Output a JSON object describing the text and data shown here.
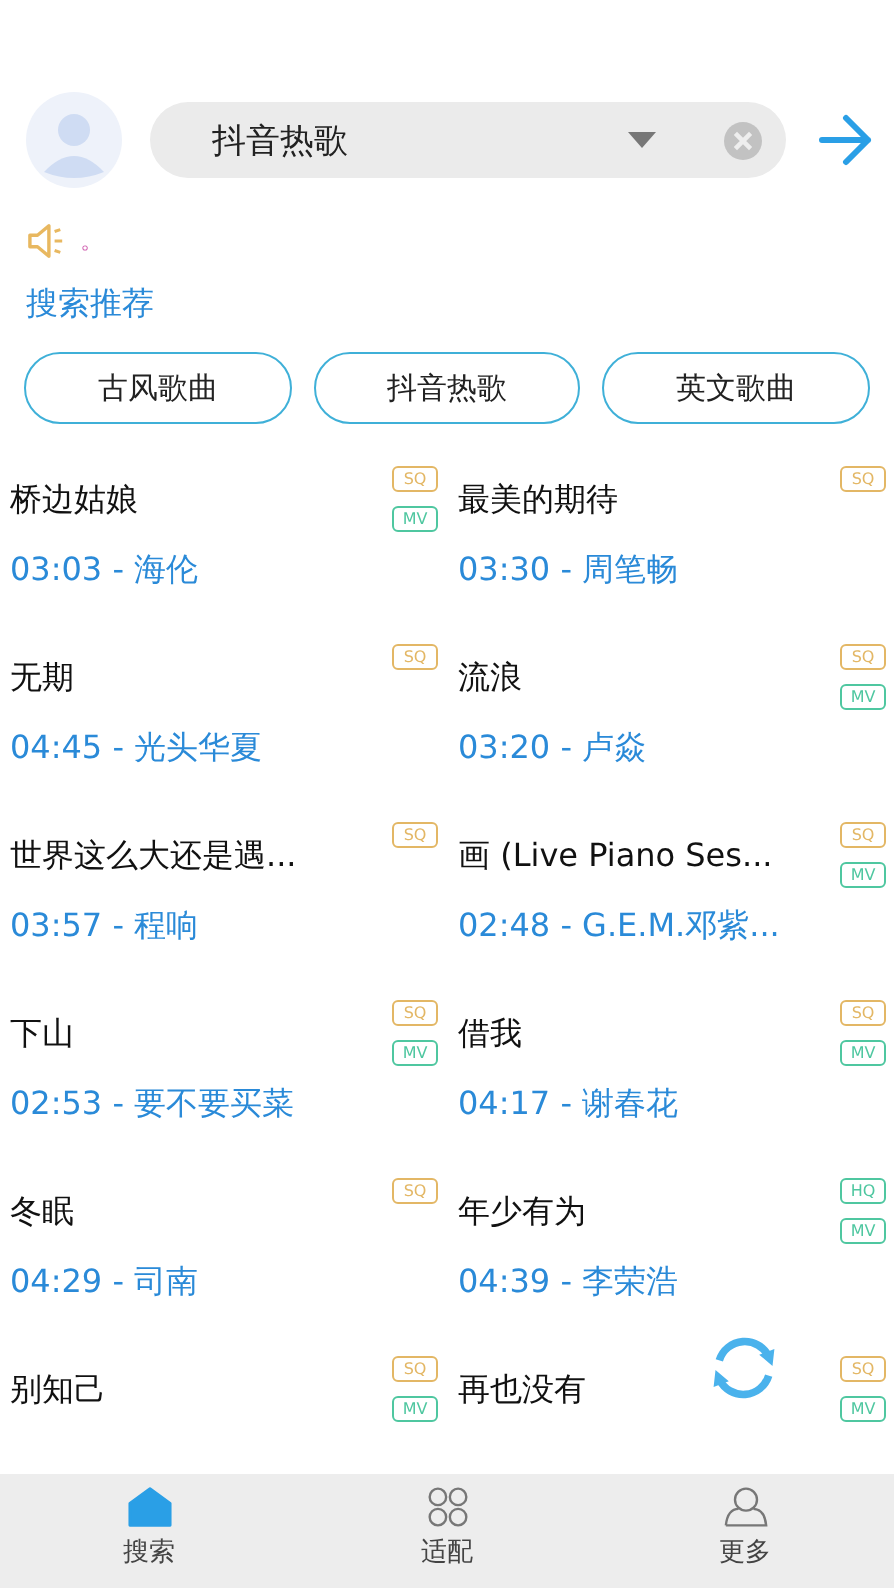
{
  "search": {
    "value": "抖音热歌"
  },
  "notice": {
    "text": "。"
  },
  "recommend": {
    "title": "搜索推荐",
    "chips": [
      "古风歌曲",
      "抖音热歌",
      "英文歌曲"
    ]
  },
  "songs": [
    {
      "title": "桥边姑娘",
      "subtitle": "03:03 - 海伦",
      "badges": [
        {
          "label": "SQ",
          "color": "#e3b765"
        },
        {
          "label": "MV",
          "color": "#4fc7a0"
        }
      ]
    },
    {
      "title": "最美的期待",
      "subtitle": "03:30 - 周笔畅",
      "badges": [
        {
          "label": "SQ",
          "color": "#e3b765"
        }
      ]
    },
    {
      "title": "无期",
      "subtitle": "04:45 - 光头华夏",
      "badges": [
        {
          "label": "SQ",
          "color": "#e3b765"
        }
      ]
    },
    {
      "title": "流浪",
      "subtitle": "03:20 - 卢焱",
      "badges": [
        {
          "label": "SQ",
          "color": "#e3b765"
        },
        {
          "label": "MV",
          "color": "#4fc7a0"
        }
      ]
    },
    {
      "title": "世界这么大还是遇...",
      "subtitle": "03:57 - 程响",
      "badges": [
        {
          "label": "SQ",
          "color": "#e3b765"
        }
      ]
    },
    {
      "title": "画 (Live Piano Ses...",
      "subtitle": "02:48 - G.E.M.邓紫...",
      "badges": [
        {
          "label": "SQ",
          "color": "#e3b765"
        },
        {
          "label": "MV",
          "color": "#4fc7a0"
        }
      ]
    },
    {
      "title": "下山",
      "subtitle": "02:53 - 要不要买菜",
      "badges": [
        {
          "label": "SQ",
          "color": "#e3b765"
        },
        {
          "label": "MV",
          "color": "#4fc7a0"
        }
      ]
    },
    {
      "title": "借我",
      "subtitle": "04:17 - 谢春花",
      "badges": [
        {
          "label": "SQ",
          "color": "#e3b765"
        },
        {
          "label": "MV",
          "color": "#4fc7a0"
        }
      ]
    },
    {
      "title": "冬眠",
      "subtitle": "04:29 - 司南",
      "badges": [
        {
          "label": "SQ",
          "color": "#e3b765"
        }
      ]
    },
    {
      "title": "年少有为",
      "subtitle": "04:39 - 李荣浩",
      "badges": [
        {
          "label": "HQ",
          "color": "#4fc7a0"
        },
        {
          "label": "MV",
          "color": "#4fc7a0"
        }
      ]
    },
    {
      "title": "别知己",
      "badges": [
        {
          "label": "SQ",
          "color": "#e3b765"
        },
        {
          "label": "MV",
          "color": "#4fc7a0"
        }
      ]
    },
    {
      "title": "再也没有",
      "badges": [
        {
          "label": "SQ",
          "color": "#e3b765"
        },
        {
          "label": "MV",
          "color": "#4fc7a0"
        }
      ]
    }
  ],
  "nav": [
    {
      "label": "搜索",
      "kind": "home",
      "selected": true
    },
    {
      "label": "适配",
      "kind": "grid",
      "selected": false
    },
    {
      "label": "更多",
      "kind": "person",
      "selected": false
    }
  ]
}
